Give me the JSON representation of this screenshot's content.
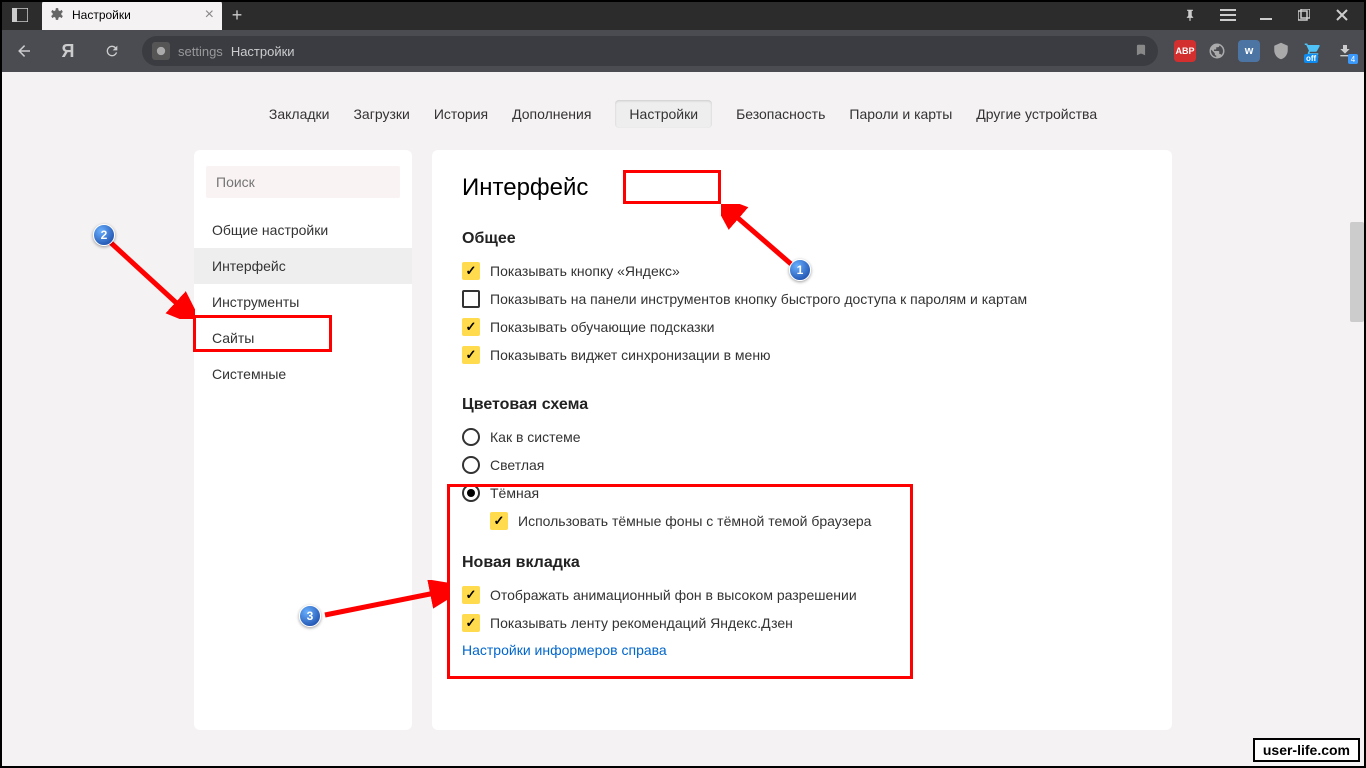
{
  "titlebar": {
    "tab_title": "Настройки"
  },
  "navbar": {
    "address_prefix": "settings",
    "address_text": "Настройки",
    "download_badge": "4"
  },
  "top_tabs": [
    "Закладки",
    "Загрузки",
    "История",
    "Дополнения",
    "Настройки",
    "Безопасность",
    "Пароли и карты",
    "Другие устройства"
  ],
  "sidebar": {
    "search_placeholder": "Поиск",
    "items": [
      "Общие настройки",
      "Интерфейс",
      "Инструменты",
      "Сайты",
      "Системные"
    ]
  },
  "main": {
    "heading": "Интерфейс",
    "section1": {
      "title": "Общее",
      "opts": [
        "Показывать кнопку «Яндекс»",
        "Показывать на панели инструментов кнопку быстрого доступа к паролям и картам",
        "Показывать обучающие подсказки",
        "Показывать виджет синхронизации в меню"
      ]
    },
    "section2": {
      "title": "Цветовая схема",
      "radios": [
        "Как в системе",
        "Светлая",
        "Тёмная"
      ],
      "sub_option": "Использовать тёмные фоны с тёмной темой браузера"
    },
    "section3": {
      "title": "Новая вкладка",
      "opts": [
        "Отображать анимационный фон в высоком разрешении",
        "Показывать ленту рекомендаций Яндекс.Дзен"
      ],
      "link": "Настройки информеров справа"
    }
  },
  "markers": {
    "m1": "1",
    "m2": "2",
    "m3": "3"
  },
  "watermark": "user-life.com"
}
